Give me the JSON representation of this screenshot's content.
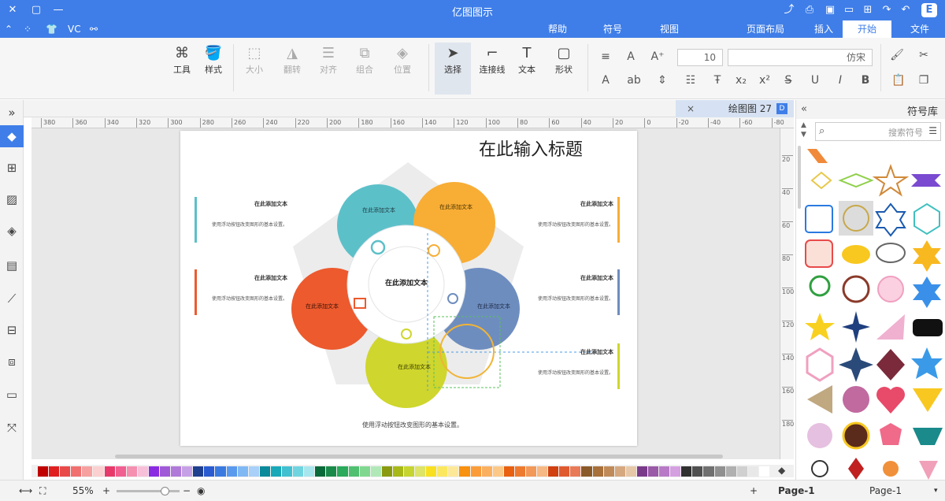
{
  "window": {
    "title": "亿图图示"
  },
  "menu": {
    "items": [
      "文件",
      "开始",
      "插入",
      "页面布局",
      "视图",
      "符号",
      "帮助"
    ],
    "active": "开始",
    "quick_access": "VC"
  },
  "ribbon": {
    "tools_label": "工具",
    "style_label": "样式",
    "size_label": "大小",
    "flip_label": "翻转",
    "align_label": "对齐",
    "group_label": "组合",
    "position_label": "位置",
    "select_label": "选择",
    "connector_label": "连接线",
    "text_label": "文本",
    "shape_label": "形状",
    "font_size": "10",
    "font_name": "仿宋"
  },
  "document": {
    "tab_label": "绘图图 27",
    "close": "×"
  },
  "rulers": {
    "horizontal_ticks": [
      "380",
      "360",
      "340",
      "320",
      "300",
      "280",
      "260",
      "240",
      "220",
      "200",
      "180",
      "160",
      "140",
      "120",
      "100",
      "80",
      "60",
      "40",
      "20",
      "0",
      "-20",
      "-40",
      "-60",
      "-80"
    ],
    "vertical_ticks": [
      "20",
      "40",
      "60",
      "80",
      "100",
      "120",
      "140",
      "160",
      "180"
    ]
  },
  "diagram": {
    "title": "在此输入标题",
    "center_text": "在此添加文本",
    "petal_text": "在此添加文本",
    "footer": "使用浮动按钮改变图形的基本设置。",
    "side_blocks": [
      {
        "heading": "在此添加文本",
        "body": "使用浮动按钮改变图形的基本设置。"
      },
      {
        "heading": "在此添加文本",
        "body": "使用浮动按钮改变图形的基本设置。"
      },
      {
        "heading": "在此添加文本",
        "body": "使用浮动按钮改变图形的基本设置。"
      },
      {
        "heading": "在此添加文本",
        "body": "使用浮动按钮改变图形的基本设置。"
      },
      {
        "heading": "在此添加文本",
        "body": "使用浮动按钮改变图形的基本设置。"
      }
    ],
    "colors": {
      "teal": "#5cc0c9",
      "orange": "#f8ad35",
      "blue": "#6e8dbf",
      "lime": "#cfd62d",
      "red": "#ec5a2e",
      "pentagon": "#ececec"
    }
  },
  "status": {
    "page_label": "Page-1",
    "page_selector": "Page-1",
    "add_page": "+",
    "zoom": "55%",
    "zoom_minus": "−",
    "zoom_plus": "+"
  },
  "symbol_library": {
    "title": "符号库",
    "search_placeholder": "搜索符号"
  },
  "palette_colors": [
    "#c00000",
    "#e02020",
    "#e84a4a",
    "#f07070",
    "#f6a0a0",
    "#fbd0d0",
    "#e83a6a",
    "#f06090",
    "#f590b0",
    "#f8c0d8",
    "#8a2be2",
    "#a05ad8",
    "#b07ad8",
    "#c6a0e6",
    "#1f3f8f",
    "#2a5bd0",
    "#3a7ae0",
    "#5a9aee",
    "#80b8f4",
    "#a8d0f8",
    "#0a8a9a",
    "#18a8b8",
    "#40c0d0",
    "#70d4e0",
    "#a8e6ee",
    "#0a6a3a",
    "#1a8a4a",
    "#2aaa5a",
    "#50c070",
    "#80d890",
    "#b0e8b8",
    "#8a9a10",
    "#a8b818",
    "#c6d430",
    "#dde468",
    "#f8e020",
    "#fbe860",
    "#fde898",
    "#f89010",
    "#fa9c3a",
    "#fbb060",
    "#fcc888",
    "#e86010",
    "#ee7a30",
    "#f29858",
    "#f6b884",
    "#d04010",
    "#e05a30",
    "#e87a58",
    "#8a5a2a",
    "#a8703a",
    "#c08a58",
    "#d6a880",
    "#e6c8a8",
    "#7a3a8a",
    "#9a5aa8",
    "#b87ac6",
    "#d4a0e0",
    "#303030",
    "#505050",
    "#707070",
    "#909090",
    "#b0b0b0",
    "#d0d0d0",
    "#e8e8e8",
    "#ffffff"
  ]
}
